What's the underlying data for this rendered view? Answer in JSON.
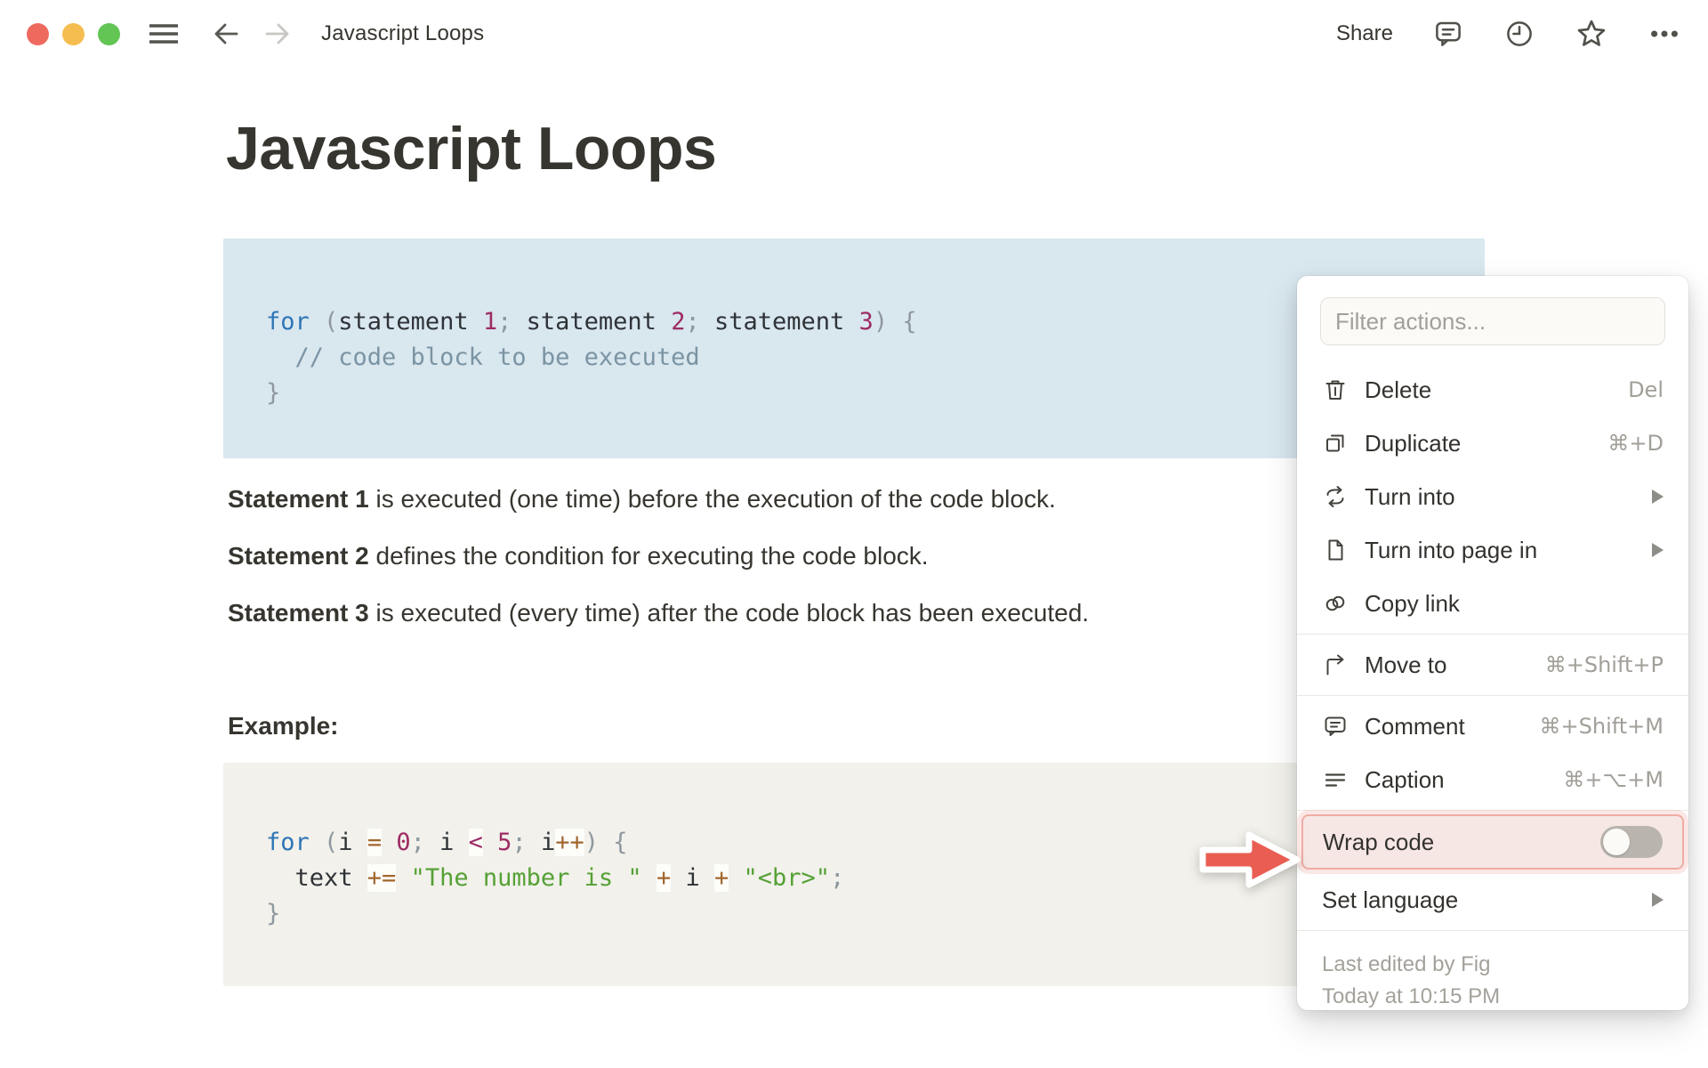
{
  "window": {
    "nav_title": "Javascript Loops",
    "share_label": "Share"
  },
  "article": {
    "title": "Javascript Loops",
    "paragraphs": [
      {
        "lead": "Statement 1",
        "text": " is executed (one time) before the execution of the code block."
      },
      {
        "lead": "Statement 2",
        "text": " defines the condition for executing the code block."
      },
      {
        "lead": "Statement 3",
        "text": " is executed (every time) after the code block has been executed."
      }
    ],
    "example_label": "Example:"
  },
  "code_blocks": [
    {
      "name": "for-loop-syntax",
      "bg": "#d9e7ef",
      "lines": [
        [
          [
            "kw",
            "for"
          ],
          [
            "pun",
            " ("
          ],
          [
            "plain",
            "statement "
          ],
          [
            "num",
            "1"
          ],
          [
            "pun",
            "; "
          ],
          [
            "plain",
            "statement "
          ],
          [
            "num",
            "2"
          ],
          [
            "pun",
            "; "
          ],
          [
            "plain",
            "statement "
          ],
          [
            "num",
            "3"
          ],
          [
            "pun",
            ") {"
          ]
        ],
        [
          [
            "com",
            "  // code block to be executed"
          ]
        ],
        [
          [
            "pun",
            "}"
          ]
        ]
      ]
    },
    {
      "name": "for-loop-example",
      "bg": "#f2f1eb",
      "lines": [
        [
          [
            "kw",
            "for"
          ],
          [
            "pun",
            " ("
          ],
          [
            "plain",
            "i "
          ],
          [
            "op",
            "="
          ],
          [
            "plain",
            " "
          ],
          [
            "num",
            "0"
          ],
          [
            "pun",
            "; "
          ],
          [
            "plain",
            "i "
          ],
          [
            "rel",
            "<"
          ],
          [
            "plain",
            " "
          ],
          [
            "num",
            "5"
          ],
          [
            "pun",
            "; "
          ],
          [
            "plain",
            "i"
          ],
          [
            "op",
            "++"
          ],
          [
            "pun",
            ") {"
          ]
        ],
        [
          [
            "plain",
            "  text "
          ],
          [
            "op",
            "+="
          ],
          [
            "plain",
            " "
          ],
          [
            "str",
            "\"The number is \""
          ],
          [
            "plain",
            " "
          ],
          [
            "op",
            "+"
          ],
          [
            "plain",
            " i "
          ],
          [
            "op",
            "+"
          ],
          [
            "plain",
            " "
          ],
          [
            "str",
            "\"<br>\""
          ],
          [
            "pun",
            ";"
          ]
        ],
        [
          [
            "pun",
            "}"
          ]
        ]
      ]
    }
  ],
  "menu": {
    "filter_placeholder": "Filter actions...",
    "items": [
      {
        "label": "Delete",
        "shortcut": "Del",
        "icon": "trash-icon"
      },
      {
        "label": "Duplicate",
        "shortcut": "⌘+D",
        "icon": "duplicate-icon"
      },
      {
        "label": "Turn into",
        "icon": "turn-into-icon"
      },
      {
        "label": "Turn into page in",
        "icon": "page-icon"
      },
      {
        "label": "Copy link",
        "icon": "link-icon"
      },
      {
        "label": "Move to",
        "shortcut": "⌘+Shift+P",
        "icon": "move-to-icon"
      },
      {
        "label": "Comment",
        "shortcut": "⌘+Shift+M",
        "icon": "comment-icon"
      },
      {
        "label": "Caption",
        "shortcut": "⌘+⌥+M",
        "icon": "caption-icon"
      },
      {
        "label": "Wrap code",
        "toggle_state": "off"
      },
      {
        "label": "Set language"
      }
    ],
    "footer": {
      "line1": "Last edited by Fig",
      "line2": "Today at 10:15 PM"
    }
  },
  "colors": {
    "annotation_red": "#e95d52",
    "highlight_bg": "#f6e7e4",
    "highlight_border": "#efaca4",
    "code_syntax_bg": "#d9e7ef",
    "code_example_bg": "#f2f1eb",
    "keyword_blue": "#2e75b6",
    "number_magenta": "#9d2c64",
    "operator_brown": "#a2672d",
    "string_green": "#55a135",
    "comment_slate": "#7b94a3"
  }
}
